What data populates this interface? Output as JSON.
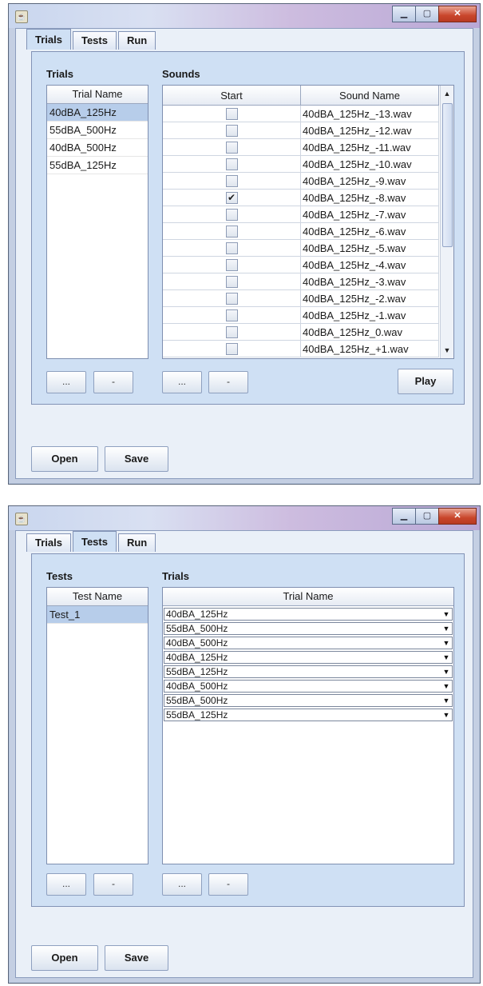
{
  "window1": {
    "tabs": [
      "Trials",
      "Tests",
      "Run"
    ],
    "selected_tab": "Trials",
    "left_label": "Trials",
    "left_header": "Trial Name",
    "left_items": [
      "40dBA_125Hz",
      "55dBA_500Hz",
      "40dBA_500Hz",
      "55dBA_125Hz"
    ],
    "right_label": "Sounds",
    "right_headers": [
      "Start",
      "Sound Name"
    ],
    "sounds": [
      {
        "start": false,
        "name": "40dBA_125Hz_-13.wav"
      },
      {
        "start": false,
        "name": "40dBA_125Hz_-12.wav"
      },
      {
        "start": false,
        "name": "40dBA_125Hz_-11.wav"
      },
      {
        "start": false,
        "name": "40dBA_125Hz_-10.wav"
      },
      {
        "start": false,
        "name": "40dBA_125Hz_-9.wav"
      },
      {
        "start": true,
        "name": "40dBA_125Hz_-8.wav"
      },
      {
        "start": false,
        "name": "40dBA_125Hz_-7.wav"
      },
      {
        "start": false,
        "name": "40dBA_125Hz_-6.wav"
      },
      {
        "start": false,
        "name": "40dBA_125Hz_-5.wav"
      },
      {
        "start": false,
        "name": "40dBA_125Hz_-4.wav"
      },
      {
        "start": false,
        "name": "40dBA_125Hz_-3.wav"
      },
      {
        "start": false,
        "name": "40dBA_125Hz_-2.wav"
      },
      {
        "start": false,
        "name": "40dBA_125Hz_-1.wav"
      },
      {
        "start": false,
        "name": "40dBA_125Hz_0.wav"
      },
      {
        "start": false,
        "name": "40dBA_125Hz_+1.wav"
      }
    ],
    "add_label": "...",
    "remove_label": "-",
    "play_label": "Play",
    "open_label": "Open",
    "save_label": "Save"
  },
  "window2": {
    "tabs": [
      "Trials",
      "Tests",
      "Run"
    ],
    "selected_tab": "Tests",
    "left_label": "Tests",
    "left_header": "Test Name",
    "left_items": [
      "Test_1"
    ],
    "right_label": "Trials",
    "right_header": "Trial Name",
    "trial_combos": [
      "40dBA_125Hz",
      "55dBA_500Hz",
      "40dBA_500Hz",
      "40dBA_125Hz",
      "55dBA_125Hz",
      "40dBA_500Hz",
      "55dBA_500Hz",
      "55dBA_125Hz"
    ],
    "add_label": "...",
    "remove_label": "-",
    "open_label": "Open",
    "save_label": "Save"
  },
  "colors": {
    "selection": "#b7cdea",
    "panel": "#cfe0f4",
    "close_button": "#c9462c"
  }
}
